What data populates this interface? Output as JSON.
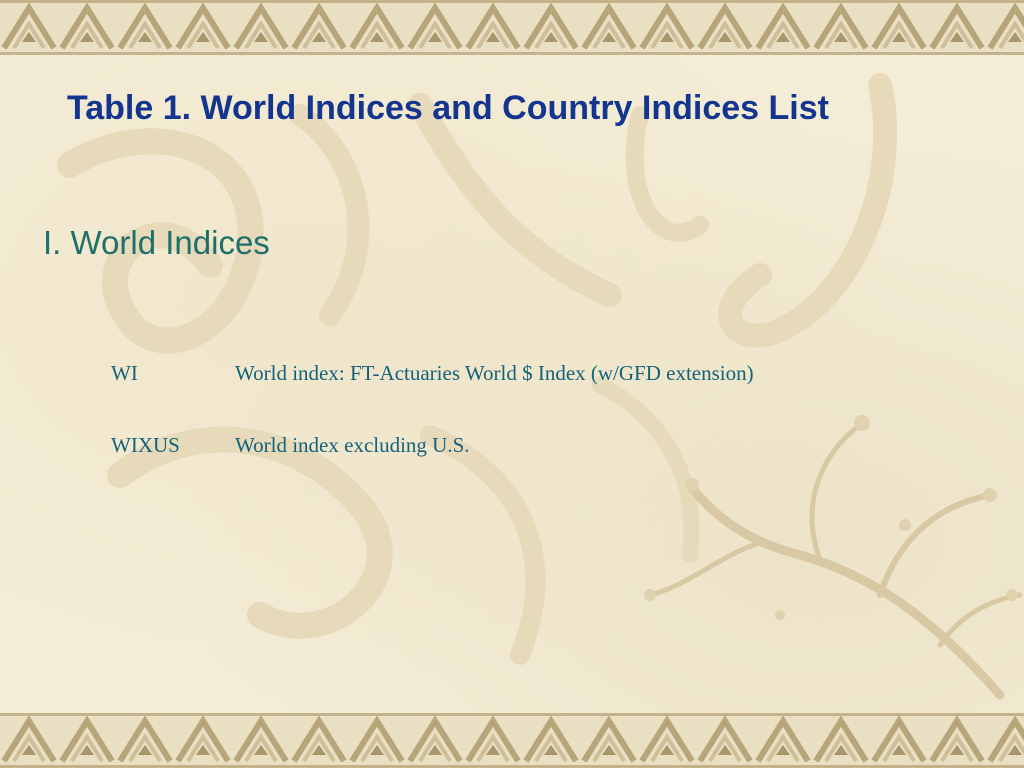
{
  "slide": {
    "title": "Table 1. World Indices and Country Indices List",
    "section_heading": "I. World Indices",
    "indices": [
      {
        "code": "WI",
        "description": "World index: FT-Actuaries World $ Index (w/GFD extension)"
      },
      {
        "code": "WIXUS",
        "description": "World index excluding U.S."
      }
    ]
  },
  "theme": {
    "background": "#f4edd6",
    "border_pattern": "key-fret-band",
    "title_color": "#14358f",
    "heading_color": "#1f6f6a",
    "body_color": "#14627a",
    "decorative_art": [
      "calligraphy-watermark",
      "plum-blossom-branch"
    ]
  }
}
